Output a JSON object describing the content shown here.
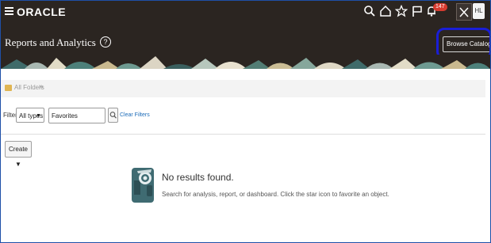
{
  "app": {
    "logo": "ORACLE",
    "notification_count": "147",
    "user_initials": "HL"
  },
  "header": {
    "title": "Reports and Analytics",
    "help_symbol": "?",
    "browse_catalog_label": "Browse Catalog"
  },
  "breadcrumb": {
    "root_label": "All Folders",
    "separator": "»"
  },
  "filter": {
    "label": "Filter",
    "type_value": "All types",
    "search_value": "Favorites",
    "clear_label": "Clear Filters"
  },
  "toolbar": {
    "create_label": "Create ▼"
  },
  "empty_state": {
    "title": "No results found.",
    "description": "Search for analysis, report, or dashboard. Click the star icon to favorite an object."
  },
  "colors": {
    "topbar": "#2b2521",
    "badge": "#d63b2f",
    "link": "#1b6bb8",
    "highlight": "#1a1ed6"
  }
}
